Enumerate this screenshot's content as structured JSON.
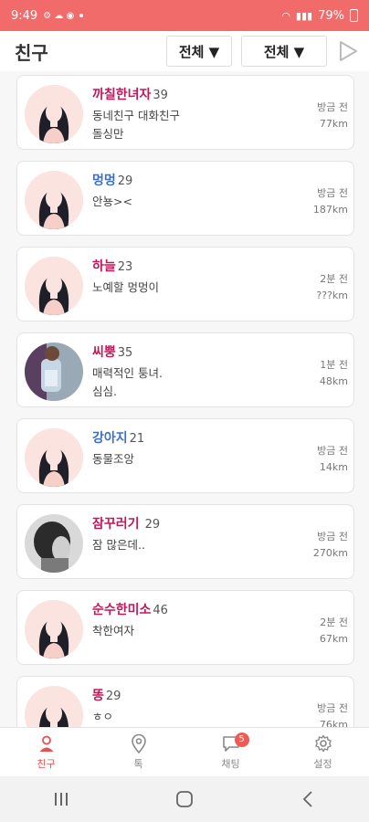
{
  "status": {
    "time": "9:49",
    "battery": "79%",
    "colors": {
      "bar": "#f26b6b"
    }
  },
  "appbar": {
    "title": "친구",
    "filter1": "전체 ▼",
    "filter2": "전체 ▼"
  },
  "friends": [
    {
      "nick": "까칠한녀자",
      "gender": "f",
      "age": "39",
      "msg1": "동네친구 대화친구",
      "msg2": "돌싱만",
      "time": "방금 전",
      "dist": "77km",
      "avatar": "default"
    },
    {
      "nick": "멍멍",
      "gender": "m",
      "age": "29",
      "msg1": "안뇽><",
      "msg2": "",
      "time": "방금 전",
      "dist": "187km",
      "avatar": "default"
    },
    {
      "nick": "하늘",
      "gender": "f",
      "age": "23",
      "msg1": "노예할 멍멍이",
      "msg2": "",
      "time": "2분 전",
      "dist": "???km",
      "avatar": "default"
    },
    {
      "nick": "씨뿡",
      "gender": "f",
      "age": "35",
      "msg1": "매력적인 퉁녀.",
      "msg2": "심심.",
      "time": "1분 전",
      "dist": "48km",
      "avatar": "photo1"
    },
    {
      "nick": "강아지",
      "gender": "m",
      "age": "21",
      "msg1": "동물조앙",
      "msg2": "",
      "time": "방금 전",
      "dist": "14km",
      "avatar": "default"
    },
    {
      "nick": "잠꾸러기",
      "gender": "f",
      "age": " 29",
      "msg1": "잠 많은데..",
      "msg2": "",
      "time": "방금 전",
      "dist": "270km",
      "avatar": "photo2"
    },
    {
      "nick": "순수한미소",
      "gender": "f",
      "age": "46",
      "msg1": "착한여자",
      "msg2": "",
      "time": "2분 전",
      "dist": "67km",
      "avatar": "default"
    },
    {
      "nick": "똥",
      "gender": "f",
      "age": "29",
      "msg1": "ㅎㅇ",
      "msg2": "",
      "time": "방금 전",
      "dist": "76km",
      "avatar": "default"
    }
  ],
  "tabs": [
    {
      "label": "친구",
      "icon": "person-icon",
      "active": true
    },
    {
      "label": "톡",
      "icon": "location-pin-icon",
      "active": false
    },
    {
      "label": "채팅",
      "icon": "chat-bubble-icon",
      "active": false,
      "badge": "5"
    },
    {
      "label": "설정",
      "icon": "gear-icon",
      "active": false
    }
  ]
}
